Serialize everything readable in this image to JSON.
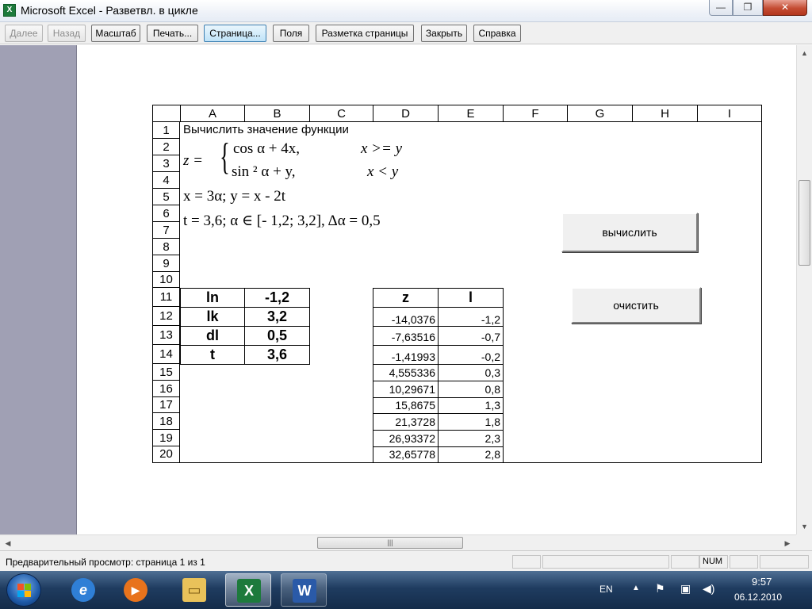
{
  "window": {
    "title": "Microsoft Excel - Разветвл. в цикле",
    "app_icon": "X",
    "minimize_glyph": "—",
    "maximize_glyph": "❐",
    "close_glyph": "✕"
  },
  "toolbar": {
    "next": "Далее",
    "back": "Назад",
    "zoom": "Масштаб",
    "print": "Печать...",
    "setup": "Страница...",
    "margins": "Поля",
    "page_break": "Разметка страницы",
    "close": "Закрыть",
    "help": "Справка"
  },
  "sheet": {
    "columns": [
      "A",
      "B",
      "C",
      "D",
      "E",
      "F",
      "G",
      "H",
      "I"
    ],
    "rows": [
      "1",
      "2",
      "3",
      "4",
      "5",
      "6",
      "7",
      "8",
      "9",
      "10",
      "11",
      "12",
      "13",
      "14",
      "15",
      "16",
      "17",
      "18",
      "19",
      "20"
    ],
    "a1_text": "Вычислить значение функции",
    "formula": {
      "z_lhs": "z = ",
      "case1_fn": "cos α + 4x,",
      "case1_cond": "x >=  y",
      "case2_fn": "sin ² α + y,",
      "case2_cond": "x < y",
      "row5": "x = 3α;    y = x - 2t",
      "row6": "t = 3,6;   α ∈ [- 1,2;  3,2],   Δα = 0,5"
    },
    "params": [
      {
        "name": "ln",
        "value": "-1,2"
      },
      {
        "name": "lk",
        "value": "3,2"
      },
      {
        "name": "dl",
        "value": "0,5"
      },
      {
        "name": "t",
        "value": "3,6"
      }
    ],
    "results_header": {
      "z": "z",
      "l": "l"
    },
    "results": [
      {
        "z": "-14,0376",
        "l": "-1,2"
      },
      {
        "z": "-7,63516",
        "l": "-0,7"
      },
      {
        "z": "-1,41993",
        "l": "-0,2"
      },
      {
        "z": "4,555336",
        "l": "0,3"
      },
      {
        "z": "10,29671",
        "l": "0,8"
      },
      {
        "z": "15,8675",
        "l": "1,3"
      },
      {
        "z": "21,3728",
        "l": "1,8"
      },
      {
        "z": "26,93372",
        "l": "2,3"
      },
      {
        "z": "32,65778",
        "l": "2,8"
      }
    ],
    "btn_calculate": "вычислить",
    "btn_clear": "очистить"
  },
  "scrollbars": {
    "up": "▲",
    "down": "▼",
    "left": "◀",
    "right": "▶",
    "grip_v": "≡",
    "grip_h": "|||"
  },
  "statusbar": {
    "text": "Предварительный просмотр: страница 1 из 1",
    "num": "NUM"
  },
  "taskbar": {
    "lang": "EN",
    "time": "9:57",
    "date": "06.12.2010",
    "tray_up": "▲",
    "items": [
      {
        "icon": "internet-explorer-icon",
        "glyph": "e"
      },
      {
        "icon": "media-player-icon",
        "glyph": "▶"
      },
      {
        "icon": "folder-icon",
        "glyph": "▭"
      },
      {
        "icon": "excel-icon",
        "glyph": "X"
      },
      {
        "icon": "word-icon",
        "glyph": "W"
      }
    ]
  }
}
